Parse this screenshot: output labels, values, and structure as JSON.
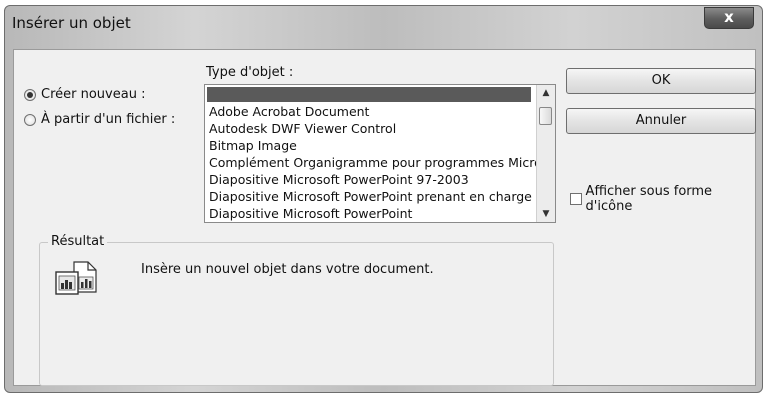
{
  "window": {
    "title": "Insérer un objet",
    "close_label": "x"
  },
  "options": {
    "create_new": "Créer nouveau :",
    "from_file": "À partir d'un fichier :",
    "selected": "create_new"
  },
  "object_type": {
    "label": "Type d'objet :",
    "items": [
      "Adobe Acrobat Document",
      "Autodesk DWF Viewer Control",
      "Bitmap Image",
      "Complément Organigramme pour programmes Micro",
      "Diapositive Microsoft PowerPoint 97-2003",
      "Diapositive Microsoft PowerPoint prenant en charge",
      "Diapositive Microsoft PowerPoint"
    ]
  },
  "buttons": {
    "ok": "OK",
    "cancel": "Annuler"
  },
  "display_as_icon": {
    "label": "Afficher sous forme d'icône",
    "checked": false
  },
  "result": {
    "label": "Résultat",
    "text": "Insère un nouvel objet  dans votre document."
  }
}
